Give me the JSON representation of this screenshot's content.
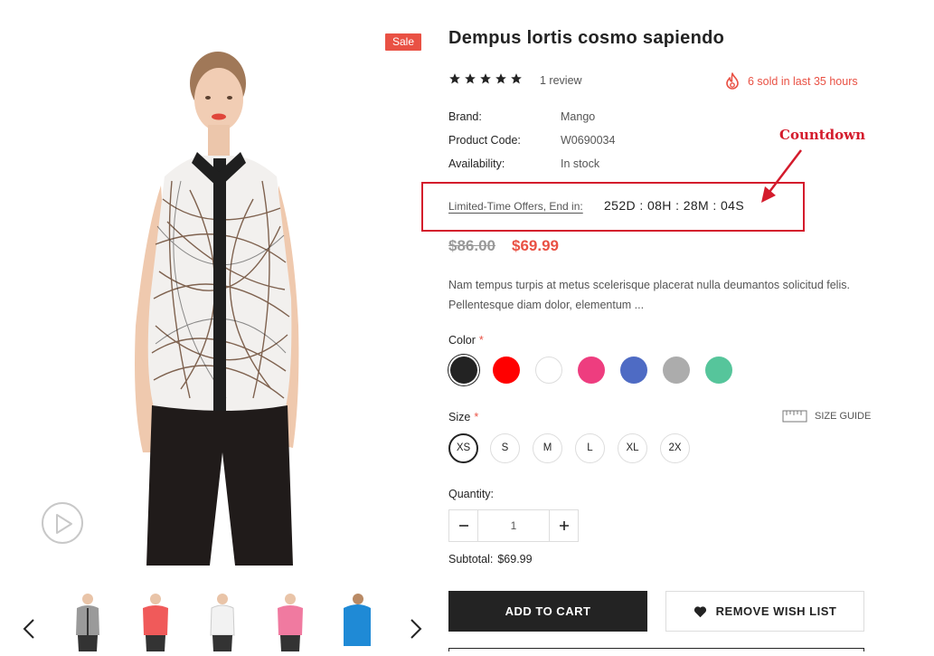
{
  "product": {
    "title": "Dempus lortis cosmo sapiendo",
    "sale_badge": "Sale",
    "rating": 5,
    "review_label": "1 review",
    "sold_text": "6 sold in last 35 hours",
    "meta": [
      {
        "label": "Brand:",
        "value": "Mango"
      },
      {
        "label": "Product Code:",
        "value": "W0690034"
      },
      {
        "label": "Availability:",
        "value": "In stock"
      }
    ],
    "offer_label": "Limited-Time Offers, End in:",
    "countdown": "252D : 08H : 28M : 04S",
    "annotation": "Countdown",
    "old_price": "$86.00",
    "new_price": "$69.99",
    "description": "Nam tempus turpis at metus scelerisque placerat nulla deumantos solicitud felis. Pellentesque diam dolor, elementum ...",
    "color_label": "Color",
    "required_mark": "*",
    "colors": [
      "#232323",
      "#ff0000",
      "#ffffff",
      "#ee3d7f",
      "#4e6bc4",
      "#acacac",
      "#56c59b"
    ],
    "size_label": "Size",
    "sizes": [
      "XS",
      "S",
      "M",
      "L",
      "XL",
      "2X"
    ],
    "size_guide": "SIZE GUIDE",
    "quantity_label": "Quantity:",
    "quantity_value": "1",
    "subtotal_label": "Subtotal:",
    "subtotal_value": "$69.99",
    "add_to_cart": "ADD TO CART",
    "wishlist": "REMOVE WISH LIST"
  },
  "theme": {
    "accent": "#e95144",
    "dark": "#232323",
    "annotation": "#d41b2c"
  },
  "gallery": {
    "thumb_colors": [
      "#8a8a8a",
      "#f05a5a",
      "#f2f2f2",
      "#f07aa0",
      "#1f8ad6"
    ]
  }
}
